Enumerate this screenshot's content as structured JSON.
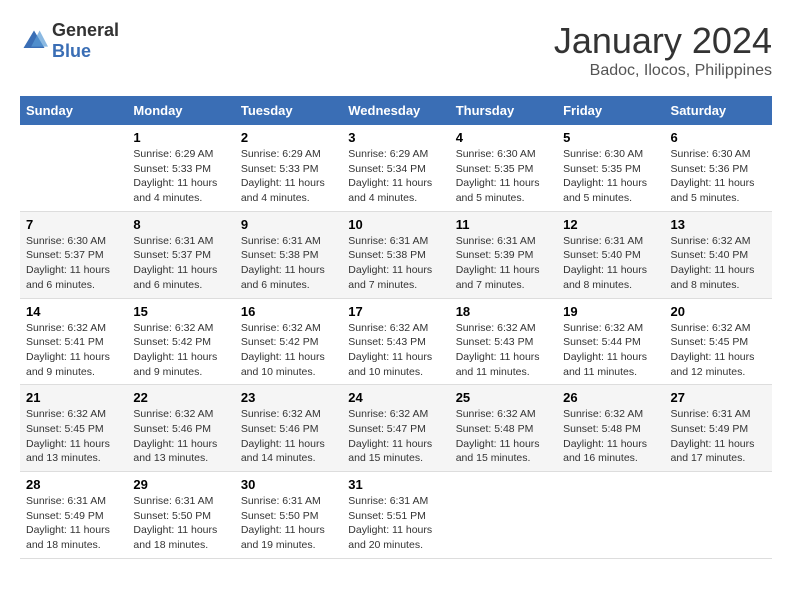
{
  "logo": {
    "general": "General",
    "blue": "Blue"
  },
  "title": "January 2024",
  "subtitle": "Badoc, Ilocos, Philippines",
  "days_of_week": [
    "Sunday",
    "Monday",
    "Tuesday",
    "Wednesday",
    "Thursday",
    "Friday",
    "Saturday"
  ],
  "weeks": [
    [
      {
        "day": "",
        "info": ""
      },
      {
        "day": "1",
        "info": "Sunrise: 6:29 AM\nSunset: 5:33 PM\nDaylight: 11 hours\nand 4 minutes."
      },
      {
        "day": "2",
        "info": "Sunrise: 6:29 AM\nSunset: 5:33 PM\nDaylight: 11 hours\nand 4 minutes."
      },
      {
        "day": "3",
        "info": "Sunrise: 6:29 AM\nSunset: 5:34 PM\nDaylight: 11 hours\nand 4 minutes."
      },
      {
        "day": "4",
        "info": "Sunrise: 6:30 AM\nSunset: 5:35 PM\nDaylight: 11 hours\nand 5 minutes."
      },
      {
        "day": "5",
        "info": "Sunrise: 6:30 AM\nSunset: 5:35 PM\nDaylight: 11 hours\nand 5 minutes."
      },
      {
        "day": "6",
        "info": "Sunrise: 6:30 AM\nSunset: 5:36 PM\nDaylight: 11 hours\nand 5 minutes."
      }
    ],
    [
      {
        "day": "7",
        "info": "Sunrise: 6:30 AM\nSunset: 5:37 PM\nDaylight: 11 hours\nand 6 minutes."
      },
      {
        "day": "8",
        "info": "Sunrise: 6:31 AM\nSunset: 5:37 PM\nDaylight: 11 hours\nand 6 minutes."
      },
      {
        "day": "9",
        "info": "Sunrise: 6:31 AM\nSunset: 5:38 PM\nDaylight: 11 hours\nand 6 minutes."
      },
      {
        "day": "10",
        "info": "Sunrise: 6:31 AM\nSunset: 5:38 PM\nDaylight: 11 hours\nand 7 minutes."
      },
      {
        "day": "11",
        "info": "Sunrise: 6:31 AM\nSunset: 5:39 PM\nDaylight: 11 hours\nand 7 minutes."
      },
      {
        "day": "12",
        "info": "Sunrise: 6:31 AM\nSunset: 5:40 PM\nDaylight: 11 hours\nand 8 minutes."
      },
      {
        "day": "13",
        "info": "Sunrise: 6:32 AM\nSunset: 5:40 PM\nDaylight: 11 hours\nand 8 minutes."
      }
    ],
    [
      {
        "day": "14",
        "info": "Sunrise: 6:32 AM\nSunset: 5:41 PM\nDaylight: 11 hours\nand 9 minutes."
      },
      {
        "day": "15",
        "info": "Sunrise: 6:32 AM\nSunset: 5:42 PM\nDaylight: 11 hours\nand 9 minutes."
      },
      {
        "day": "16",
        "info": "Sunrise: 6:32 AM\nSunset: 5:42 PM\nDaylight: 11 hours\nand 10 minutes."
      },
      {
        "day": "17",
        "info": "Sunrise: 6:32 AM\nSunset: 5:43 PM\nDaylight: 11 hours\nand 10 minutes."
      },
      {
        "day": "18",
        "info": "Sunrise: 6:32 AM\nSunset: 5:43 PM\nDaylight: 11 hours\nand 11 minutes."
      },
      {
        "day": "19",
        "info": "Sunrise: 6:32 AM\nSunset: 5:44 PM\nDaylight: 11 hours\nand 11 minutes."
      },
      {
        "day": "20",
        "info": "Sunrise: 6:32 AM\nSunset: 5:45 PM\nDaylight: 11 hours\nand 12 minutes."
      }
    ],
    [
      {
        "day": "21",
        "info": "Sunrise: 6:32 AM\nSunset: 5:45 PM\nDaylight: 11 hours\nand 13 minutes."
      },
      {
        "day": "22",
        "info": "Sunrise: 6:32 AM\nSunset: 5:46 PM\nDaylight: 11 hours\nand 13 minutes."
      },
      {
        "day": "23",
        "info": "Sunrise: 6:32 AM\nSunset: 5:46 PM\nDaylight: 11 hours\nand 14 minutes."
      },
      {
        "day": "24",
        "info": "Sunrise: 6:32 AM\nSunset: 5:47 PM\nDaylight: 11 hours\nand 15 minutes."
      },
      {
        "day": "25",
        "info": "Sunrise: 6:32 AM\nSunset: 5:48 PM\nDaylight: 11 hours\nand 15 minutes."
      },
      {
        "day": "26",
        "info": "Sunrise: 6:32 AM\nSunset: 5:48 PM\nDaylight: 11 hours\nand 16 minutes."
      },
      {
        "day": "27",
        "info": "Sunrise: 6:31 AM\nSunset: 5:49 PM\nDaylight: 11 hours\nand 17 minutes."
      }
    ],
    [
      {
        "day": "28",
        "info": "Sunrise: 6:31 AM\nSunset: 5:49 PM\nDaylight: 11 hours\nand 18 minutes."
      },
      {
        "day": "29",
        "info": "Sunrise: 6:31 AM\nSunset: 5:50 PM\nDaylight: 11 hours\nand 18 minutes."
      },
      {
        "day": "30",
        "info": "Sunrise: 6:31 AM\nSunset: 5:50 PM\nDaylight: 11 hours\nand 19 minutes."
      },
      {
        "day": "31",
        "info": "Sunrise: 6:31 AM\nSunset: 5:51 PM\nDaylight: 11 hours\nand 20 minutes."
      },
      {
        "day": "",
        "info": ""
      },
      {
        "day": "",
        "info": ""
      },
      {
        "day": "",
        "info": ""
      }
    ]
  ]
}
